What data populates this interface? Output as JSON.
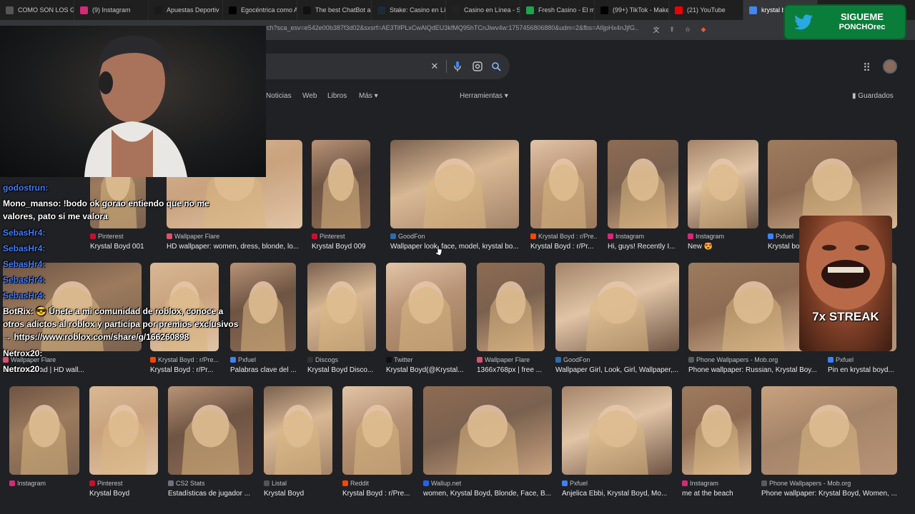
{
  "tabs": [
    {
      "label": "COMO SON LOS GI",
      "color": "#555"
    },
    {
      "label": "(9) Instagram",
      "color": "#d62976"
    },
    {
      "label": "Apuestas Deportiv",
      "color": "#1a1a1a"
    },
    {
      "label": "Egocéntrica como A",
      "color": "#000"
    },
    {
      "label": "The best ChatBot ar",
      "color": "#111"
    },
    {
      "label": "Stake: Casino en Lír",
      "color": "#1a2c38"
    },
    {
      "label": "Casino en Línea - SI",
      "color": "#222"
    },
    {
      "label": "Fresh Casino - El m",
      "color": "#1ea44a"
    },
    {
      "label": "(99+) TikTok - Make",
      "color": "#000"
    },
    {
      "label": "(21) YouTube",
      "color": "#e00"
    },
    {
      "label": "krystal bo",
      "color": "#4285f4"
    }
  ],
  "url": "rch?sca_esv=e542e00b387f3d02&sxsrf=AE3TifPLxCwAlQdEU3kfMQ95hTCnJiwv4w:1757456806880&udm=2&fbs=AIljpHx4nJjfG..",
  "nav": {
    "news": "Noticias",
    "web": "Web",
    "books": "Libros",
    "more": "Más",
    "tools": "Herramientas",
    "saved": "Guardados"
  },
  "twitter": {
    "line1": "SIGUEME",
    "line2": "PONCHOrec"
  },
  "streak": "7x STREAK",
  "chat": [
    "godostrun:",
    "Mono_manso: !bodo ok gorao entiendo que no me",
    "valores, pato si me valora",
    "SebasHr4:",
    "SebasHr4:",
    "SebasHr4:",
    "SebasHr4:",
    "SebasHr4:",
    "BotRix: 😎 Únete a mi comunidad de roblox, conoce a",
    "otros adictos al roblox y participa por premios exclusivos",
    "→ https://www.roblox.com/share/g/166260898",
    "Netrox20:",
    "Netrox20:"
  ],
  "row1": [
    {
      "source": "Pinterest",
      "title": "Krystal Boyd 001",
      "c": "#c8102e"
    },
    {
      "source": "Wallpaper Flare",
      "title": "HD wallpaper: women, dress, blonde, lo...",
      "c": "#e04f6b"
    },
    {
      "source": "Pinterest",
      "title": "Krystal Boyd 009",
      "c": "#c8102e"
    },
    {
      "source": "GoodFon",
      "title": "Wallpaper look, face, model, krystal bo...",
      "c": "#2b6cb0"
    },
    {
      "source": "Krystal Boyd : r/Pre...",
      "title": "Krystal Boyd : r/Pr...",
      "c": "#ff4500"
    },
    {
      "source": "Instagram",
      "title": "Hi, guys! Recently I...",
      "c": "#d62976"
    },
    {
      "source": "Instagram",
      "title": "New 😍",
      "c": "#d62976"
    },
    {
      "source": "Pxfuel",
      "title": "Krystal bo",
      "c": "#3b82f6"
    }
  ],
  "row2": [
    {
      "source": "Wallpaper Flare",
      "title": "free download | HD wall...",
      "c": "#e04f6b"
    },
    {
      "source": "Krystal Boyd : r/Pre...",
      "title": "Krystal Boyd : r/Pr...",
      "c": "#ff4500"
    },
    {
      "source": "Pxfuel",
      "title": "Palabras clave del ...",
      "c": "#3b82f6"
    },
    {
      "source": "Discogs",
      "title": "Krystal Boyd Disco...",
      "c": "#333"
    },
    {
      "source": "Twitter",
      "title": "Krystal Boyd(@Krystal...",
      "c": "#111"
    },
    {
      "source": "Wallpaper Flare",
      "title": "1366x768px | free ...",
      "c": "#e04f6b"
    },
    {
      "source": "GoodFon",
      "title": "Wallpaper Girl, Look, Girl, Wallpaper,...",
      "c": "#2b6cb0"
    },
    {
      "source": "Phone Wallpapers - Mob.org",
      "title": "Phone wallpaper: Russian, Krystal Boy...",
      "c": "#5b5b5b"
    },
    {
      "source": "Pxfuel",
      "title": "Pin en krystal boyd...",
      "c": "#3b82f6"
    }
  ],
  "row3": [
    {
      "source": "Instagram",
      "title": "",
      "c": "#d62976"
    },
    {
      "source": "Pinterest",
      "title": "Krystal Boyd",
      "c": "#c8102e"
    },
    {
      "source": "CS2 Stats",
      "title": "Estadísticas de jugador ...",
      "c": "#6b7280"
    },
    {
      "source": "Listal",
      "title": "Krystal Boyd",
      "c": "#555"
    },
    {
      "source": "Reddit",
      "title": "Krystal Boyd : r/Pre...",
      "c": "#ff4500"
    },
    {
      "source": "Wallup.net",
      "title": "women, Krystal Boyd, Blonde, Face, B...",
      "c": "#2563eb"
    },
    {
      "source": "Pxfuel",
      "title": "Anjelica Ebbi, Krystal Boyd, Mo...",
      "c": "#3b82f6"
    },
    {
      "source": "Instagram",
      "title": "me at the beach",
      "c": "#d62976"
    },
    {
      "source": "Phone Wallpapers - Mob.org",
      "title": "Phone wallpaper: Krystal Boyd, Women, ...",
      "c": "#5b5b5b"
    }
  ]
}
